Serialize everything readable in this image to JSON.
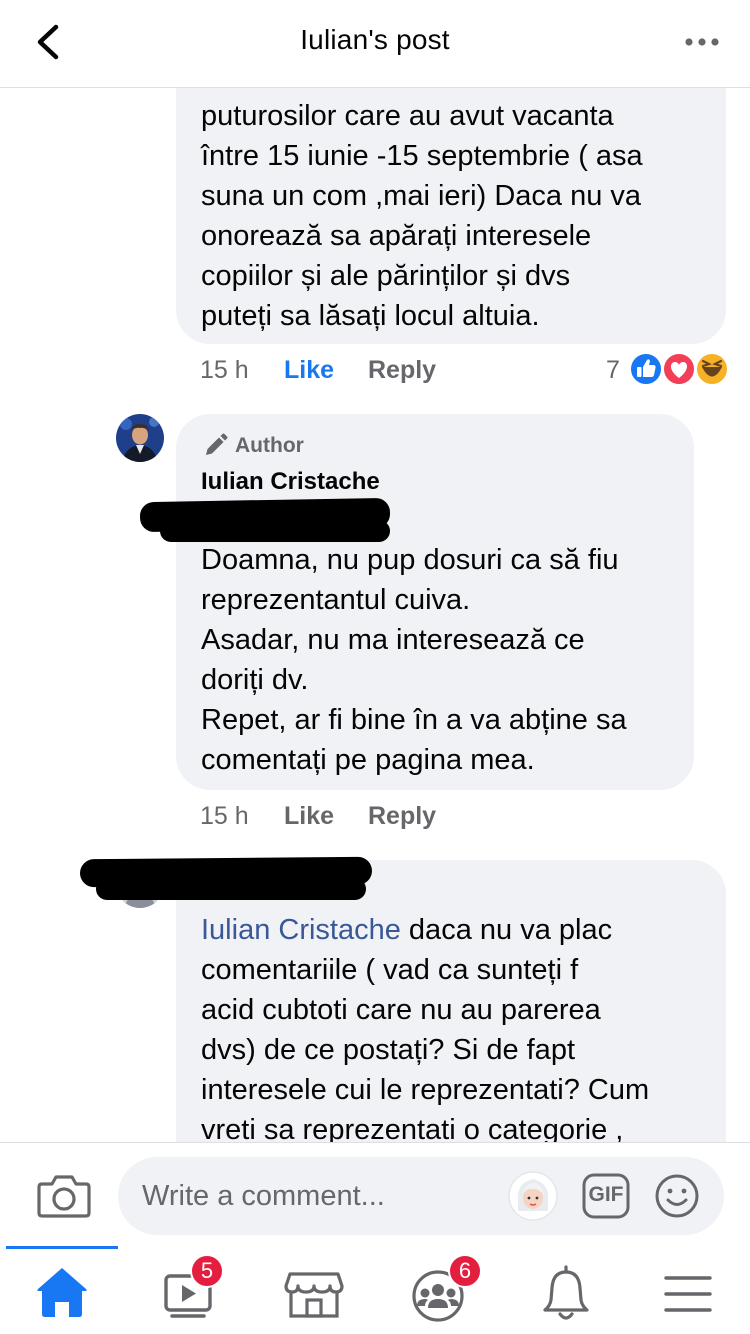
{
  "header": {
    "title": "Iulian's post",
    "back_icon": "chevron-left-icon",
    "more_icon": "more-horizontal-icon"
  },
  "comment1": {
    "lines": [
      "puturosilor care au avut vacanta",
      "între 15 iunie -15 septembrie ( asa",
      "suna un com ,mai ieri)  Daca nu va",
      "onorează sa apărați interesele",
      "copiilor și ale părinților și dvs",
      "puteți sa lăsați locul altuia."
    ],
    "time": "15 h",
    "like_label": "Like",
    "reply_label": "Reply",
    "reaction_count": "7",
    "reactions": [
      "like-reaction-icon",
      "love-reaction-icon",
      "haha-reaction-icon"
    ]
  },
  "comment2": {
    "badge_label": "Author",
    "author_name": "Iulian Cristache",
    "lines": [
      "Doamna, nu pup dosuri ca să fiu",
      "reprezentantul cuiva.",
      "Asadar, nu ma interesează ce",
      "doriți dv.",
      "Repet, ar fi bine în a va abține sa",
      "comentați pe pagina mea."
    ],
    "time": "15 h",
    "like_label": "Like",
    "reply_label": "Reply"
  },
  "comment3": {
    "mention": "Iulian Cristache",
    "first_line_rest": " daca nu va plac",
    "lines": [
      "comentariile  ( vad ca sunteți f",
      "acid cubtoti care nu au parerea",
      "dvs) de ce postați? Si de fapt",
      "interesele cui le reprezentati? Cum",
      "vreti sa reprezentati o categorie ,"
    ]
  },
  "composer": {
    "placeholder": "Write a comment...",
    "camera_icon": "camera-icon",
    "gif_label": "GIF",
    "emoji_icon": "smiley-icon"
  },
  "tabbar": {
    "tabs": [
      {
        "name": "home",
        "icon": "home-icon",
        "badge": ""
      },
      {
        "name": "watch",
        "icon": "video-icon",
        "badge": "5"
      },
      {
        "name": "marketplace",
        "icon": "marketplace-icon",
        "badge": ""
      },
      {
        "name": "groups",
        "icon": "groups-icon",
        "badge": "6"
      },
      {
        "name": "notifications",
        "icon": "bell-icon",
        "badge": ""
      },
      {
        "name": "menu",
        "icon": "menu-icon",
        "badge": ""
      }
    ]
  },
  "colors": {
    "accent": "#1877f2",
    "bubble": "#f0f2f5",
    "secondary_text": "#65676b",
    "badge": "#e41e3f",
    "mention": "#385898"
  }
}
